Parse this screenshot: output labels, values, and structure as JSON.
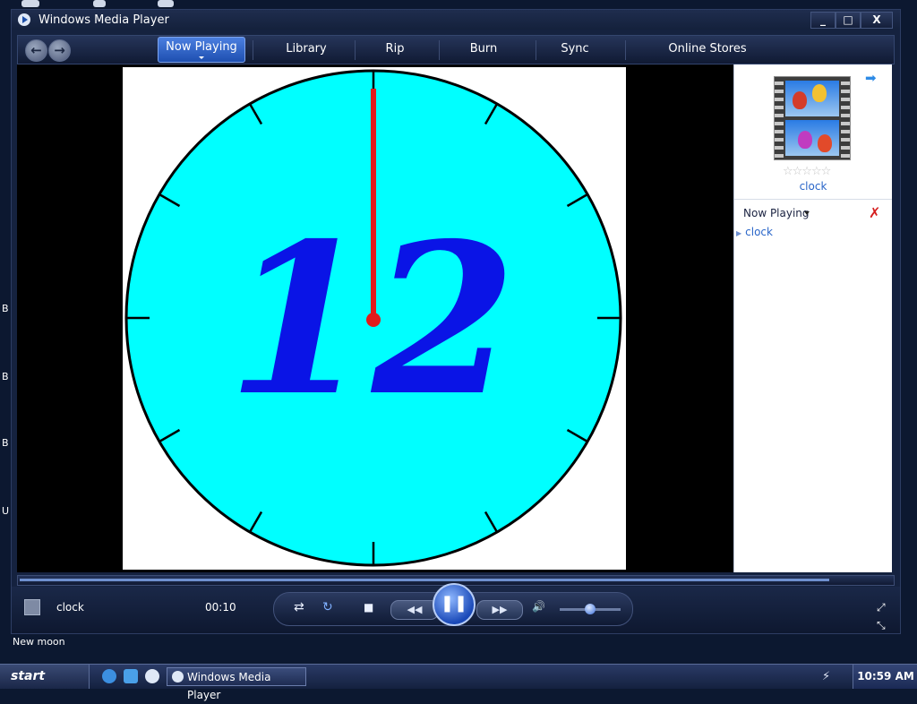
{
  "window": {
    "title": "Windows Media Player",
    "minimize": "_",
    "maximize": "□",
    "close": "X"
  },
  "nav": {
    "back": "←",
    "forward": "→"
  },
  "tabs": [
    {
      "label": "Now Playing",
      "active": true
    },
    {
      "label": "Library"
    },
    {
      "label": "Rip"
    },
    {
      "label": "Burn"
    },
    {
      "label": "Sync"
    },
    {
      "label": "Online Stores"
    }
  ],
  "video": {
    "clock_number": "12"
  },
  "pane": {
    "thumbnail_title": "clock",
    "rating_stars": "☆☆☆☆☆",
    "now_playing_label": "Now Playing",
    "playlist": [
      "clock"
    ]
  },
  "player": {
    "current_title": "clock",
    "elapsed": "00:10",
    "seek_progress": 0.93,
    "volume_level": 0.45,
    "buttons": {
      "shuffle": "⇄",
      "repeat": "↻",
      "stop": "■",
      "previous": "◀◀",
      "play_pause": "❚❚",
      "next": "▶▶",
      "mute": "🔊"
    }
  },
  "status_text": "New moon",
  "desktop": {
    "edge_labels": [
      "B",
      "B",
      "B",
      "U"
    ]
  },
  "os_taskbar": {
    "start_label": "start",
    "task_button": "Windows Media Player",
    "clock": "10:59 AM"
  },
  "colors": {
    "accent": "#1e4fb0",
    "clock_face": "#00ffff",
    "numeral": "#0a14e6",
    "hand": "#e21b1b"
  }
}
